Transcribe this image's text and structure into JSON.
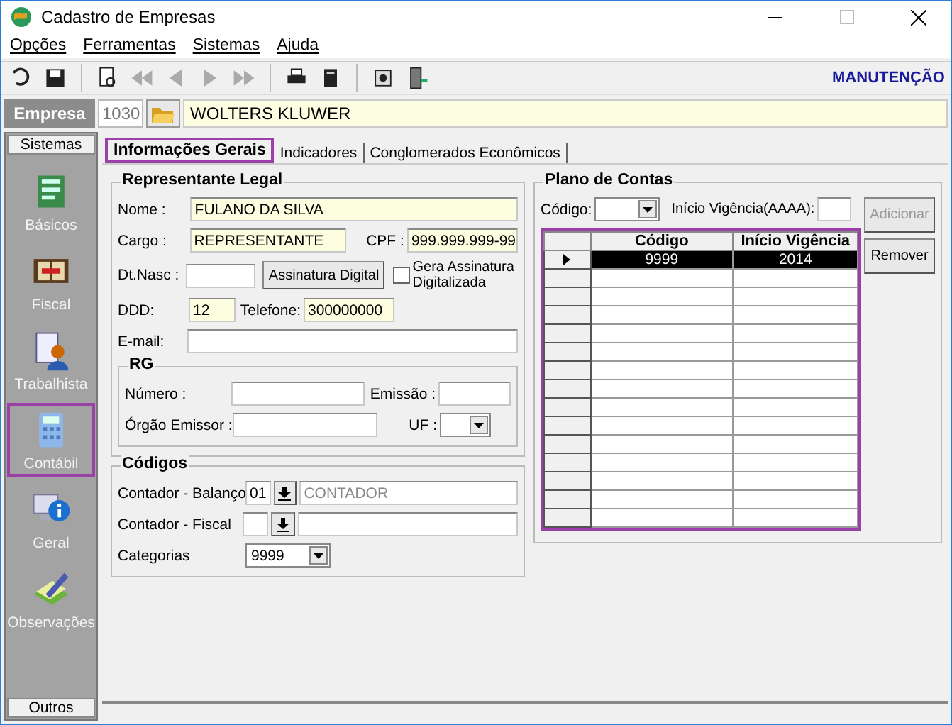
{
  "window": {
    "title": "Cadastro de Empresas"
  },
  "menu": [
    {
      "label": "Opções"
    },
    {
      "label": "Ferramentas"
    },
    {
      "label": "Sistemas"
    },
    {
      "label": "Ajuda"
    }
  ],
  "toolbar": [
    {
      "kind": "undo",
      "disabled": false
    },
    {
      "kind": "save",
      "disabled": false
    },
    {
      "kind": "sep"
    },
    {
      "kind": "preview",
      "disabled": false
    },
    {
      "kind": "first",
      "disabled": true
    },
    {
      "kind": "prev",
      "disabled": true
    },
    {
      "kind": "next",
      "disabled": true
    },
    {
      "kind": "last",
      "disabled": true
    },
    {
      "kind": "sep"
    },
    {
      "kind": "print",
      "disabled": false
    },
    {
      "kind": "report",
      "disabled": false
    },
    {
      "kind": "sep"
    },
    {
      "kind": "tools",
      "disabled": false
    },
    {
      "kind": "exit",
      "disabled": false
    }
  ],
  "mode_label": "MANUTENÇÃO",
  "empresa": {
    "label": "Empresa",
    "code": "1030",
    "name": "WOLTERS KLUWER"
  },
  "sidebar": {
    "header": "Sistemas",
    "footer": "Outros",
    "items": [
      {
        "kind": "document",
        "label": "Básicos",
        "selected": false
      },
      {
        "kind": "book",
        "label": "Fiscal",
        "selected": false
      },
      {
        "kind": "person",
        "label": "Trabalhista",
        "selected": false
      },
      {
        "kind": "calculator",
        "label": "Contábil",
        "selected": true
      },
      {
        "kind": "info",
        "label": "Geral",
        "selected": false
      },
      {
        "kind": "pencil",
        "label": "Observações",
        "selected": false
      }
    ]
  },
  "tabs": [
    {
      "label": "Informações Gerais",
      "selected": true
    },
    {
      "label": "Indicadores",
      "selected": false
    },
    {
      "label": "Conglomerados Econômicos",
      "selected": false
    }
  ],
  "representante": {
    "title": "Representante Legal",
    "nome": {
      "label": "Nome :",
      "value": "FULANO DA SILVA",
      "required": true
    },
    "cargo": {
      "label": "Cargo :",
      "value": "REPRESENTANTE",
      "required": true
    },
    "cpf": {
      "label": "CPF :",
      "value": "999.999.999-99",
      "required": true
    },
    "dt_nasc": {
      "label": "Dt.Nasc :",
      "required": false
    },
    "assinatura_button": "Assinatura Digital",
    "gera_assinatura": {
      "label": "Gera Assinatura Digitalizada",
      "checked": false
    },
    "ddd": {
      "label": "DDD:",
      "value": "12",
      "required": true
    },
    "telefone": {
      "label": "Telefone:",
      "value": "300000000",
      "required": true
    },
    "email": {
      "label": "E-mail:",
      "required": false
    }
  },
  "rg": {
    "title": "RG",
    "numero": "Número :",
    "emissao": "Emissão :",
    "orgao": "Órgão Emissor :",
    "uf": "UF :"
  },
  "codigos": {
    "title": "Códigos",
    "balanco": {
      "label": "Contador - Balanço",
      "code": "01",
      "name": "CONTADOR"
    },
    "fiscal": {
      "label": "Contador - Fiscal"
    },
    "categorias": {
      "label": "Categorias",
      "value": "9999"
    }
  },
  "plano": {
    "title": "Plano de Contas",
    "codigo_label": "Código:",
    "vigencia_label": "Início Vigência(AAAA):",
    "buttons": [
      {
        "label": "Adicionar",
        "disabled": true
      },
      {
        "label": "Remover",
        "disabled": false
      }
    ],
    "table": {
      "highlighted": true,
      "columns": [
        "Código",
        "Início Vigência"
      ],
      "rows": [
        {
          "cells": [
            "9999",
            "2014"
          ],
          "selected": true
        }
      ]
    }
  }
}
